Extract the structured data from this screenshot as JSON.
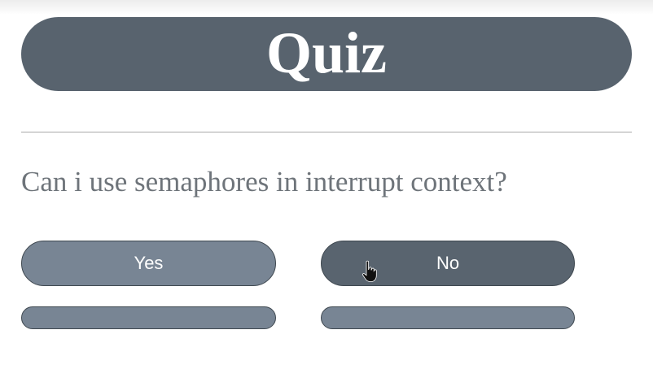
{
  "quiz": {
    "title": "Quiz",
    "question": "Can i use semaphores in interrupt context?"
  },
  "answers": [
    {
      "label": "Yes"
    },
    {
      "label": "No"
    }
  ],
  "extra_buttons": [
    {
      "label": ""
    },
    {
      "label": ""
    }
  ],
  "cursor": {
    "icon": "hand-pointer-icon"
  },
  "colors": {
    "header_bg": "#58636e",
    "button_light": "#788594",
    "button_dark": "#59646f",
    "question_text": "#6e747a",
    "divider": "#a9a9a9"
  }
}
